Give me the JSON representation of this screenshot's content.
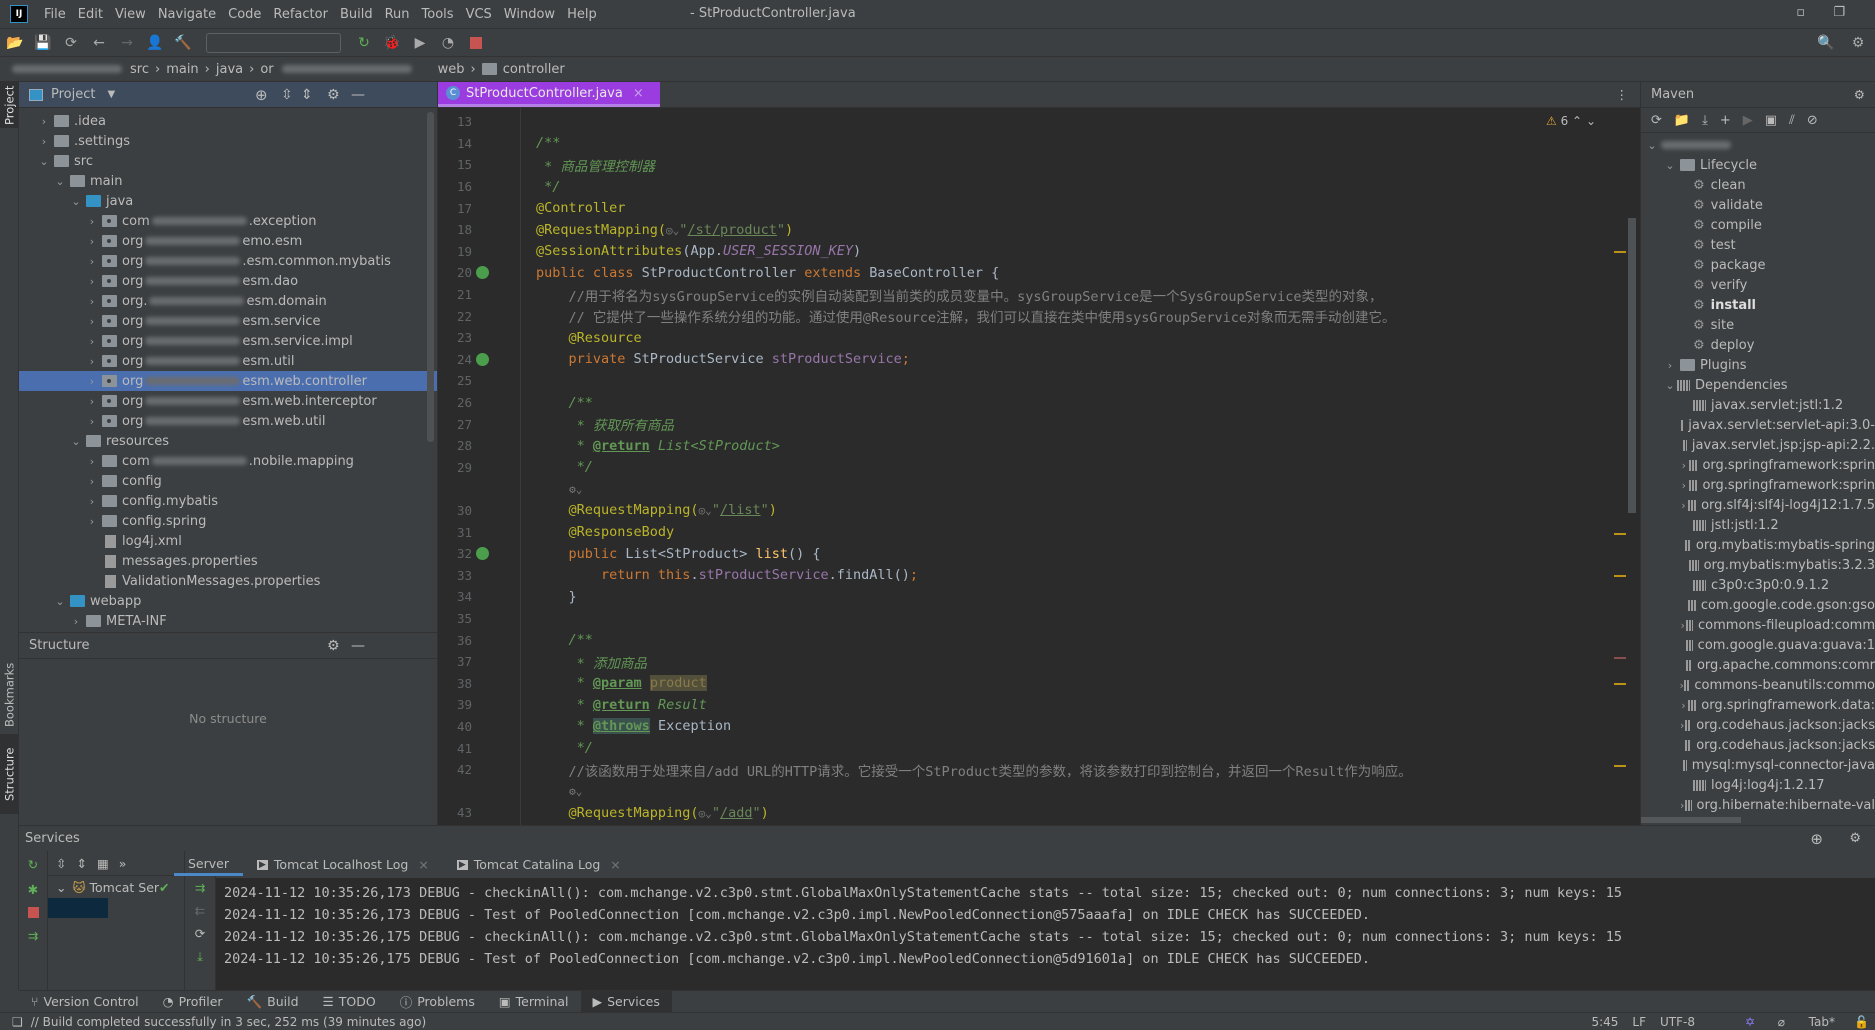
{
  "window": {
    "title": "- StProductController.java",
    "logo": "IJ"
  },
  "menu": [
    "File",
    "Edit",
    "View",
    "Navigate",
    "Code",
    "Refactor",
    "Build",
    "Run",
    "Tools",
    "VCS",
    "Window",
    "Help"
  ],
  "breadcrumb": [
    "src",
    "main",
    "java",
    "or",
    "web",
    "controller"
  ],
  "project_panel": {
    "title": "Project",
    "tree": [
      {
        "indent": 1,
        "arrow": "›",
        "icon": "folder",
        "label": ".idea"
      },
      {
        "indent": 1,
        "arrow": "›",
        "icon": "folder",
        "label": ".settings"
      },
      {
        "indent": 1,
        "arrow": "⌄",
        "icon": "folder",
        "label": "src"
      },
      {
        "indent": 2,
        "arrow": "⌄",
        "icon": "folder",
        "label": "main"
      },
      {
        "indent": 3,
        "arrow": "⌄",
        "icon": "folder-blue",
        "label": "java"
      },
      {
        "indent": 4,
        "arrow": "›",
        "icon": "package",
        "pre": "com",
        "label": ".exception"
      },
      {
        "indent": 4,
        "arrow": "›",
        "icon": "package",
        "pre": "org",
        "label": "emo.esm"
      },
      {
        "indent": 4,
        "arrow": "›",
        "icon": "package",
        "pre": "org",
        "label": ".esm.common.mybatis"
      },
      {
        "indent": 4,
        "arrow": "›",
        "icon": "package",
        "pre": "org",
        "label": "esm.dao"
      },
      {
        "indent": 4,
        "arrow": "›",
        "icon": "package",
        "pre": "org.",
        "label": "esm.domain"
      },
      {
        "indent": 4,
        "arrow": "›",
        "icon": "package",
        "pre": "org",
        "label": "esm.service"
      },
      {
        "indent": 4,
        "arrow": "›",
        "icon": "package",
        "pre": "org",
        "label": "esm.service.impl"
      },
      {
        "indent": 4,
        "arrow": "›",
        "icon": "package",
        "pre": "org",
        "label": "esm.util"
      },
      {
        "indent": 4,
        "arrow": "›",
        "icon": "package",
        "pre": "org",
        "label": "esm.web.controller",
        "selected": true
      },
      {
        "indent": 4,
        "arrow": "›",
        "icon": "package",
        "pre": "org",
        "label": "esm.web.interceptor"
      },
      {
        "indent": 4,
        "arrow": "›",
        "icon": "package",
        "pre": "org",
        "label": "esm.web.util"
      },
      {
        "indent": 3,
        "arrow": "⌄",
        "icon": "folder",
        "label": "resources"
      },
      {
        "indent": 4,
        "arrow": "›",
        "icon": "folder",
        "pre": "com",
        "label": ".nobile.mapping"
      },
      {
        "indent": 4,
        "arrow": "›",
        "icon": "folder",
        "label": "config"
      },
      {
        "indent": 4,
        "arrow": "›",
        "icon": "folder",
        "label": "config.mybatis"
      },
      {
        "indent": 4,
        "arrow": "›",
        "icon": "folder",
        "label": "config.spring"
      },
      {
        "indent": 4,
        "arrow": "",
        "icon": "file",
        "label": "log4j.xml"
      },
      {
        "indent": 4,
        "arrow": "",
        "icon": "file",
        "label": "messages.properties"
      },
      {
        "indent": 4,
        "arrow": "",
        "icon": "file",
        "label": "ValidationMessages.properties"
      },
      {
        "indent": 2,
        "arrow": "⌄",
        "icon": "folder-blue",
        "label": "webapp"
      },
      {
        "indent": 3,
        "arrow": "›",
        "icon": "folder",
        "label": "META-INF"
      }
    ]
  },
  "structure_panel": {
    "title": "Structure",
    "empty_text": "No structure"
  },
  "side_tabs": {
    "project": "Project",
    "bookmarks": "Bookmarks",
    "structure": "Structure"
  },
  "editor": {
    "tab_label": "StProductController.java",
    "warnings": "6",
    "lines": [
      {
        "n": "13",
        "t": []
      },
      {
        "n": "14",
        "t": [
          [
            "/**",
            "dc"
          ]
        ]
      },
      {
        "n": "15",
        "t": [
          [
            " * 商品管理控制器",
            "dc"
          ]
        ]
      },
      {
        "n": "16",
        "t": [
          [
            " */",
            "dc"
          ]
        ]
      },
      {
        "n": "17",
        "t": [
          [
            "@Controller",
            "an"
          ]
        ]
      },
      {
        "n": "18",
        "t": [
          [
            "@RequestMapping(",
            "an"
          ],
          [
            "◎⌄",
            "hint"
          ],
          [
            "\"",
            "st"
          ],
          [
            "/st/product",
            "sturl"
          ],
          [
            "\"",
            "st"
          ],
          [
            ")",
            "an"
          ]
        ]
      },
      {
        "n": "19",
        "t": [
          [
            "@SessionAttributes",
            "an"
          ],
          [
            "(App.",
            ""
          ],
          [
            "USER_SESSION_KEY",
            "fdi"
          ],
          [
            ")",
            ""
          ]
        ]
      },
      {
        "n": "20",
        "bean": true,
        "t": [
          [
            "public class ",
            "kw"
          ],
          [
            "StProductController ",
            ""
          ],
          [
            "extends ",
            "kw"
          ],
          [
            "BaseController {",
            ""
          ]
        ]
      },
      {
        "n": "21",
        "t": [
          [
            "    //用于将名为sysGroupService的实例自动装配到当前类的成员变量中。sysGroupService是一个SysGroupService类型的对象，",
            "cm"
          ]
        ]
      },
      {
        "n": "22",
        "t": [
          [
            "    // 它提供了一些操作系统分组的功能。通过使用@Resource注解，我们可以直接在类中使用sysGroupService对象而无需手动创建它。",
            "cm"
          ]
        ]
      },
      {
        "n": "23",
        "t": [
          [
            "    @Resource",
            "an"
          ]
        ]
      },
      {
        "n": "24",
        "bean": true,
        "t": [
          [
            "    private ",
            "kw"
          ],
          [
            "StProductService ",
            ""
          ],
          [
            "stProductService",
            "fd"
          ],
          [
            ";",
            "kw"
          ]
        ]
      },
      {
        "n": "25",
        "t": []
      },
      {
        "n": "26",
        "t": [
          [
            "    /**",
            "dc"
          ]
        ]
      },
      {
        "n": "27",
        "t": [
          [
            "     * 获取所有商品",
            "dc"
          ]
        ]
      },
      {
        "n": "28",
        "t": [
          [
            "     * ",
            "dc"
          ],
          [
            "@return",
            "dtag"
          ],
          [
            " List<StProduct>",
            "dc"
          ]
        ]
      },
      {
        "n": "29",
        "t": [
          [
            "     */",
            "dc"
          ]
        ]
      },
      {
        "n": "",
        "t": [
          [
            "     ⚙⌄",
            "hint"
          ]
        ]
      },
      {
        "n": "30",
        "t": [
          [
            "    @RequestMapping(",
            "an"
          ],
          [
            "◎⌄",
            "hint"
          ],
          [
            "\"",
            "st"
          ],
          [
            "/list",
            "sturl"
          ],
          [
            "\"",
            "st"
          ],
          [
            ")",
            "an"
          ]
        ]
      },
      {
        "n": "31",
        "t": [
          [
            "    @ResponseBody",
            "an"
          ]
        ]
      },
      {
        "n": "32",
        "bean": true,
        "t": [
          [
            "    public ",
            "kw"
          ],
          [
            "List<StProduct> ",
            ""
          ],
          [
            "list",
            "fn"
          ],
          [
            "() {",
            ""
          ]
        ]
      },
      {
        "n": "33",
        "t": [
          [
            "        return this",
            "kw"
          ],
          [
            ".",
            ""
          ],
          [
            "stProductService",
            "fd"
          ],
          [
            ".findAll()",
            ""
          ],
          [
            ";",
            "kw"
          ]
        ]
      },
      {
        "n": "34",
        "t": [
          [
            "    }",
            ""
          ]
        ]
      },
      {
        "n": "35",
        "t": []
      },
      {
        "n": "36",
        "t": [
          [
            "    /**",
            "dc"
          ]
        ]
      },
      {
        "n": "37",
        "t": [
          [
            "     * 添加商品",
            "dc"
          ]
        ]
      },
      {
        "n": "38",
        "t": [
          [
            "     * ",
            "dc"
          ],
          [
            "@param",
            "dtag"
          ],
          [
            " ",
            "dc"
          ],
          [
            "product",
            "hl"
          ]
        ]
      },
      {
        "n": "39",
        "t": [
          [
            "     * ",
            "dc"
          ],
          [
            "@return",
            "dtag"
          ],
          [
            " Result",
            "dc"
          ]
        ]
      },
      {
        "n": "40",
        "t": [
          [
            "     * ",
            "dc"
          ],
          [
            "@throws",
            "hl2"
          ],
          [
            " Exception",
            ""
          ]
        ]
      },
      {
        "n": "41",
        "t": [
          [
            "     */",
            "dc"
          ]
        ]
      },
      {
        "n": "42",
        "t": [
          [
            "    //该函数用于处理来自/add URL的HTTP请求。它接受一个StProduct类型的参数，将该参数打印到控制台，并返回一个Result作为响应。",
            "cm"
          ]
        ]
      },
      {
        "n": "",
        "t": [
          [
            "     ⚙⌄",
            "hint"
          ]
        ]
      },
      {
        "n": "43",
        "t": [
          [
            "    @RequestMapping(",
            "an"
          ],
          [
            "◎⌄",
            "hint"
          ],
          [
            "\"",
            "st"
          ],
          [
            "/add",
            "sturl"
          ],
          [
            "\"",
            "st"
          ],
          [
            ")",
            "an"
          ]
        ]
      }
    ]
  },
  "maven": {
    "title": "Maven",
    "lifecycle_label": "Lifecycle",
    "lifecycle": [
      "clean",
      "validate",
      "compile",
      "test",
      "package",
      "verify",
      "install",
      "site",
      "deploy"
    ],
    "plugins_label": "Plugins",
    "dependencies_label": "Dependencies",
    "dependencies": [
      {
        "label": "javax.servlet:jstl:1.2",
        "expandable": false
      },
      {
        "label": "javax.servlet:servlet-api:3.0-",
        "expandable": false
      },
      {
        "label": "javax.servlet.jsp:jsp-api:2.2.",
        "expandable": false
      },
      {
        "label": "org.springframework:sprin",
        "expandable": true
      },
      {
        "label": "org.springframework:sprin",
        "expandable": true
      },
      {
        "label": "org.slf4j:slf4j-log4j12:1.7.5",
        "expandable": true
      },
      {
        "label": "jstl:jstl:1.2",
        "expandable": false
      },
      {
        "label": "org.mybatis:mybatis-spring",
        "expandable": false
      },
      {
        "label": "org.mybatis:mybatis:3.2.3",
        "expandable": false
      },
      {
        "label": "c3p0:c3p0:0.9.1.2",
        "expandable": false
      },
      {
        "label": "com.google.code.gson:gso",
        "expandable": false
      },
      {
        "label": "commons-fileupload:comm",
        "expandable": true
      },
      {
        "label": "com.google.guava:guava:1",
        "expandable": false
      },
      {
        "label": "org.apache.commons:comr",
        "expandable": false
      },
      {
        "label": "commons-beanutils:commo",
        "expandable": true
      },
      {
        "label": "org.springframework.data:",
        "expandable": true
      },
      {
        "label": "org.codehaus.jackson:jacks",
        "expandable": true
      },
      {
        "label": "org.codehaus.jackson:jacks",
        "expandable": false
      },
      {
        "label": "mysql:mysql-connector-java",
        "expandable": false
      },
      {
        "label": "log4j:log4j:1.2.17",
        "expandable": false
      },
      {
        "label": "org.hibernate:hibernate-val",
        "expandable": true
      }
    ]
  },
  "services": {
    "title": "Services",
    "tabs": [
      "Server",
      "Tomcat Localhost Log",
      "Tomcat Catalina Log"
    ],
    "tree_item": "Tomcat Ser",
    "log": [
      "2024-11-12 10:35:26,173 DEBUG - checkinAll(): com.mchange.v2.c3p0.stmt.GlobalMaxOnlyStatementCache stats -- total size: 15; checked out: 0; num connections: 3; num keys: 15",
      "2024-11-12 10:35:26,173 DEBUG - Test of PooledConnection [com.mchange.v2.c3p0.impl.NewPooledConnection@575aaafa] on IDLE CHECK has SUCCEEDED.",
      "2024-11-12 10:35:26,175 DEBUG - checkinAll(): com.mchange.v2.c3p0.stmt.GlobalMaxOnlyStatementCache stats -- total size: 15; checked out: 0; num connections: 3; num keys: 15",
      "2024-11-12 10:35:26,175 DEBUG - Test of PooledConnection [com.mchange.v2.c3p0.impl.NewPooledConnection@5d91601a] on IDLE CHECK has SUCCEEDED."
    ]
  },
  "bottom_tools": [
    "Version Control",
    "Profiler",
    "Build",
    "TODO",
    "Problems",
    "Terminal",
    "Services"
  ],
  "status": {
    "message": "// Build completed successfully in 3 sec, 252 ms (39 minutes ago)",
    "position": "5:45",
    "line_sep": "LF",
    "encoding": "UTF-8",
    "indent": "Tab*"
  }
}
